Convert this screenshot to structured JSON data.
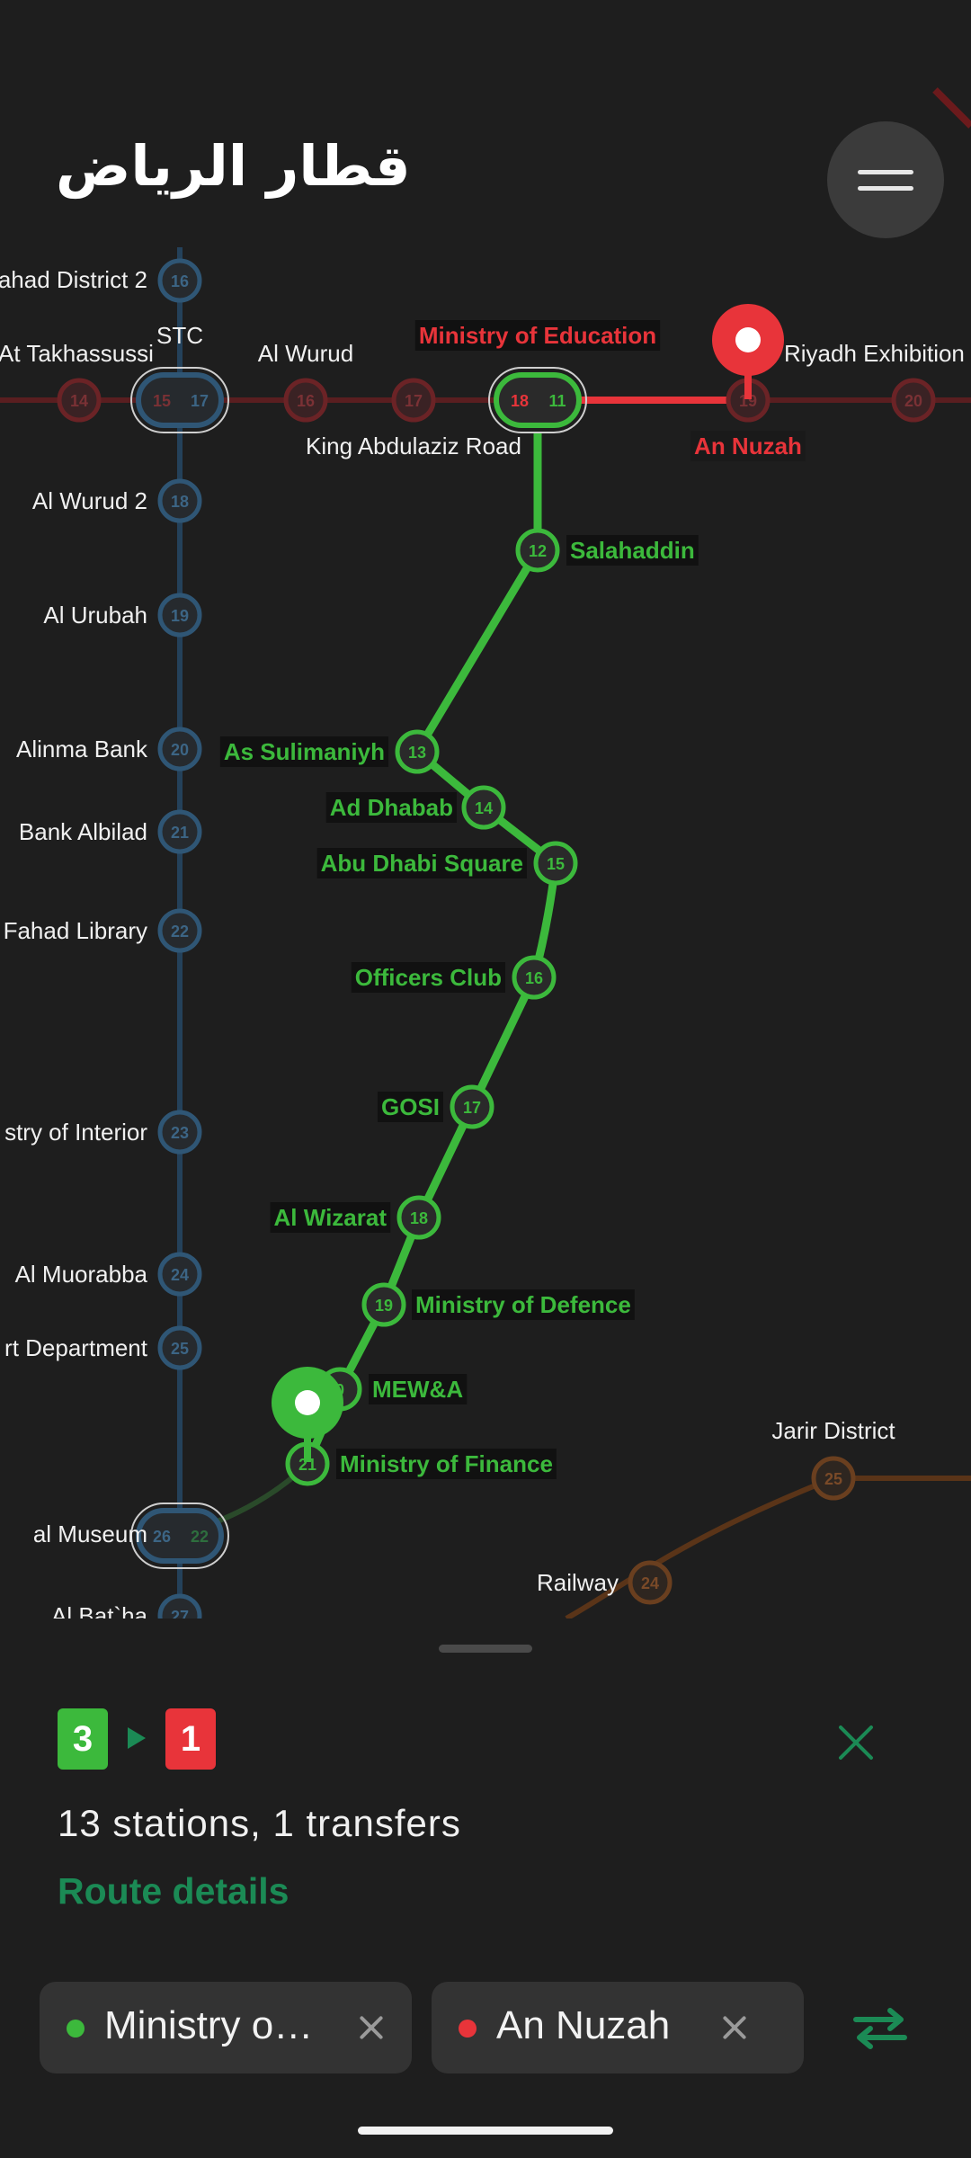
{
  "app": {
    "title": "قطار الرياض"
  },
  "colors": {
    "background": "#1e1e1e",
    "line_green": "#3cb93c",
    "line_red": "#e8343a",
    "line_blue": "#2f5675",
    "line_orange": "#6a3f1f",
    "accent": "#1b8a55"
  },
  "icons": {
    "menu": "hamburger-menu-icon",
    "close": "close-icon",
    "swap": "swap-arrows-icon",
    "pin": "location-pin-icon"
  },
  "map": {
    "blue_stations": [
      {
        "name": "ahad District 2",
        "num": "16"
      },
      {
        "name": "At Takhassussi",
        "num": ""
      },
      {
        "name": "Al Wurud 2",
        "num": "18"
      },
      {
        "name": "Al Urubah",
        "num": "19"
      },
      {
        "name": "Alinma Bank",
        "num": "20"
      },
      {
        "name": "Bank Albilad",
        "num": "21"
      },
      {
        "name": "Fahad Library",
        "num": "22"
      },
      {
        "name": "stry of Interior",
        "num": "23"
      },
      {
        "name": "Al Muorabba",
        "num": "24"
      },
      {
        "name": "rt Department",
        "num": "25"
      },
      {
        "name": "al Museum",
        "num": ""
      },
      {
        "name": "Al Bat`ha",
        "num": "27"
      }
    ],
    "red_stations": [
      {
        "name": "",
        "num": "14"
      },
      {
        "name": "STC",
        "num": ""
      },
      {
        "name": "Al Wurud",
        "num": "16"
      },
      {
        "name": "",
        "num": "17"
      },
      {
        "name": "King Abdulaziz Road",
        "num": ""
      },
      {
        "name": "An Nuzah",
        "num": "19"
      },
      {
        "name": "Riyadh Exhibition",
        "num": "20"
      }
    ],
    "interchanges": [
      {
        "nums": [
          "15",
          "17"
        ]
      },
      {
        "nums": [
          "18",
          "11"
        ]
      },
      {
        "nums": [
          "26",
          "22"
        ]
      }
    ],
    "green_stations": [
      {
        "name": "Ministry of Education",
        "num": ""
      },
      {
        "name": "Salahaddin",
        "num": "12"
      },
      {
        "name": "As Sulimaniyh",
        "num": "13"
      },
      {
        "name": "Ad Dhabab",
        "num": "14"
      },
      {
        "name": "Abu Dhabi Square",
        "num": "15"
      },
      {
        "name": "Officers Club",
        "num": "16"
      },
      {
        "name": "GOSI",
        "num": "17"
      },
      {
        "name": "Al Wizarat",
        "num": "18"
      },
      {
        "name": "Ministry of Defence",
        "num": "19"
      },
      {
        "name": "MEW&A",
        "num": "0"
      },
      {
        "name": "Ministry of Finance",
        "num": "21"
      }
    ],
    "orange_stations": [
      {
        "name": "Jarir District",
        "num": "25"
      },
      {
        "name": "Railway",
        "num": "24"
      }
    ]
  },
  "route": {
    "from_line": "3",
    "to_line": "1",
    "summary": "13 stations, 1 transfers",
    "details_link": "Route details"
  },
  "inputs": {
    "origin": "Ministry o…",
    "destination": "An Nuzah"
  }
}
